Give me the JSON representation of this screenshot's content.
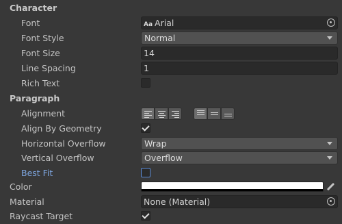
{
  "sections": {
    "character": "Character",
    "paragraph": "Paragraph"
  },
  "fields": {
    "font": {
      "label": "Font",
      "value": "Arial",
      "icon_text": "Aa"
    },
    "font_style": {
      "label": "Font Style",
      "value": "Normal"
    },
    "font_size": {
      "label": "Font Size",
      "value": "14"
    },
    "line_spacing": {
      "label": "Line Spacing",
      "value": "1"
    },
    "rich_text": {
      "label": "Rich Text",
      "checked": false
    },
    "alignment": {
      "label": "Alignment",
      "horizontal_selected": "left",
      "vertical_selected": "top"
    },
    "align_by_geometry": {
      "label": "Align By Geometry",
      "checked": true
    },
    "horizontal_overflow": {
      "label": "Horizontal Overflow",
      "value": "Wrap"
    },
    "vertical_overflow": {
      "label": "Vertical Overflow",
      "value": "Overflow"
    },
    "best_fit": {
      "label": "Best Fit",
      "checked": false
    },
    "color": {
      "label": "Color",
      "value": "#ffffff"
    },
    "material": {
      "label": "Material",
      "value": "None (Material)"
    },
    "raycast_target": {
      "label": "Raycast Target",
      "checked": true
    }
  },
  "icons": {
    "object_picker": "target-icon",
    "dropdown": "chevron-down-icon",
    "eyedropper": "eyedropper-icon"
  }
}
